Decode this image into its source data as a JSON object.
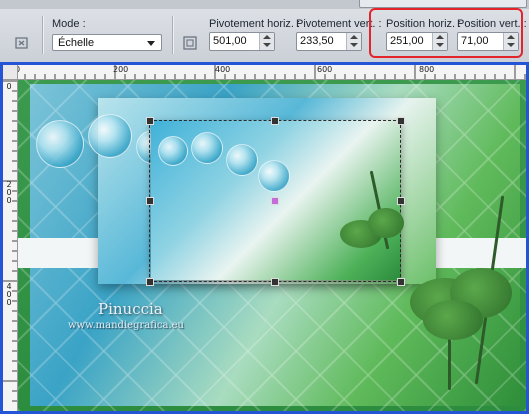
{
  "toolbar": {
    "mode_label": "Mode :",
    "mode_value": "Échelle",
    "pivot_h_label": "Pivotement horiz. :",
    "pivot_h_value": "501,00",
    "pivot_v_label": "Pivotement vert. :",
    "pivot_v_value": "233,50",
    "pos_h_label": "Position horiz. :",
    "pos_h_value": "251,00",
    "pos_v_label": "Position vert. :",
    "pos_v_value": "71,00",
    "highlight_color": "#e3242b"
  },
  "ruler": {
    "h_labels": [
      "0",
      "200",
      "400",
      "600",
      "800"
    ],
    "v_labels": [
      "0",
      "2\n0\n0",
      "4\n0\n0"
    ]
  },
  "image": {
    "watermark_title": "Pinuccia",
    "watermark_url": "www.mandiegrafica.eu"
  },
  "colors": {
    "frame_border": "#2455d6",
    "accent_green": "#2c8d3f",
    "accent_blue": "#3aa3c6"
  }
}
